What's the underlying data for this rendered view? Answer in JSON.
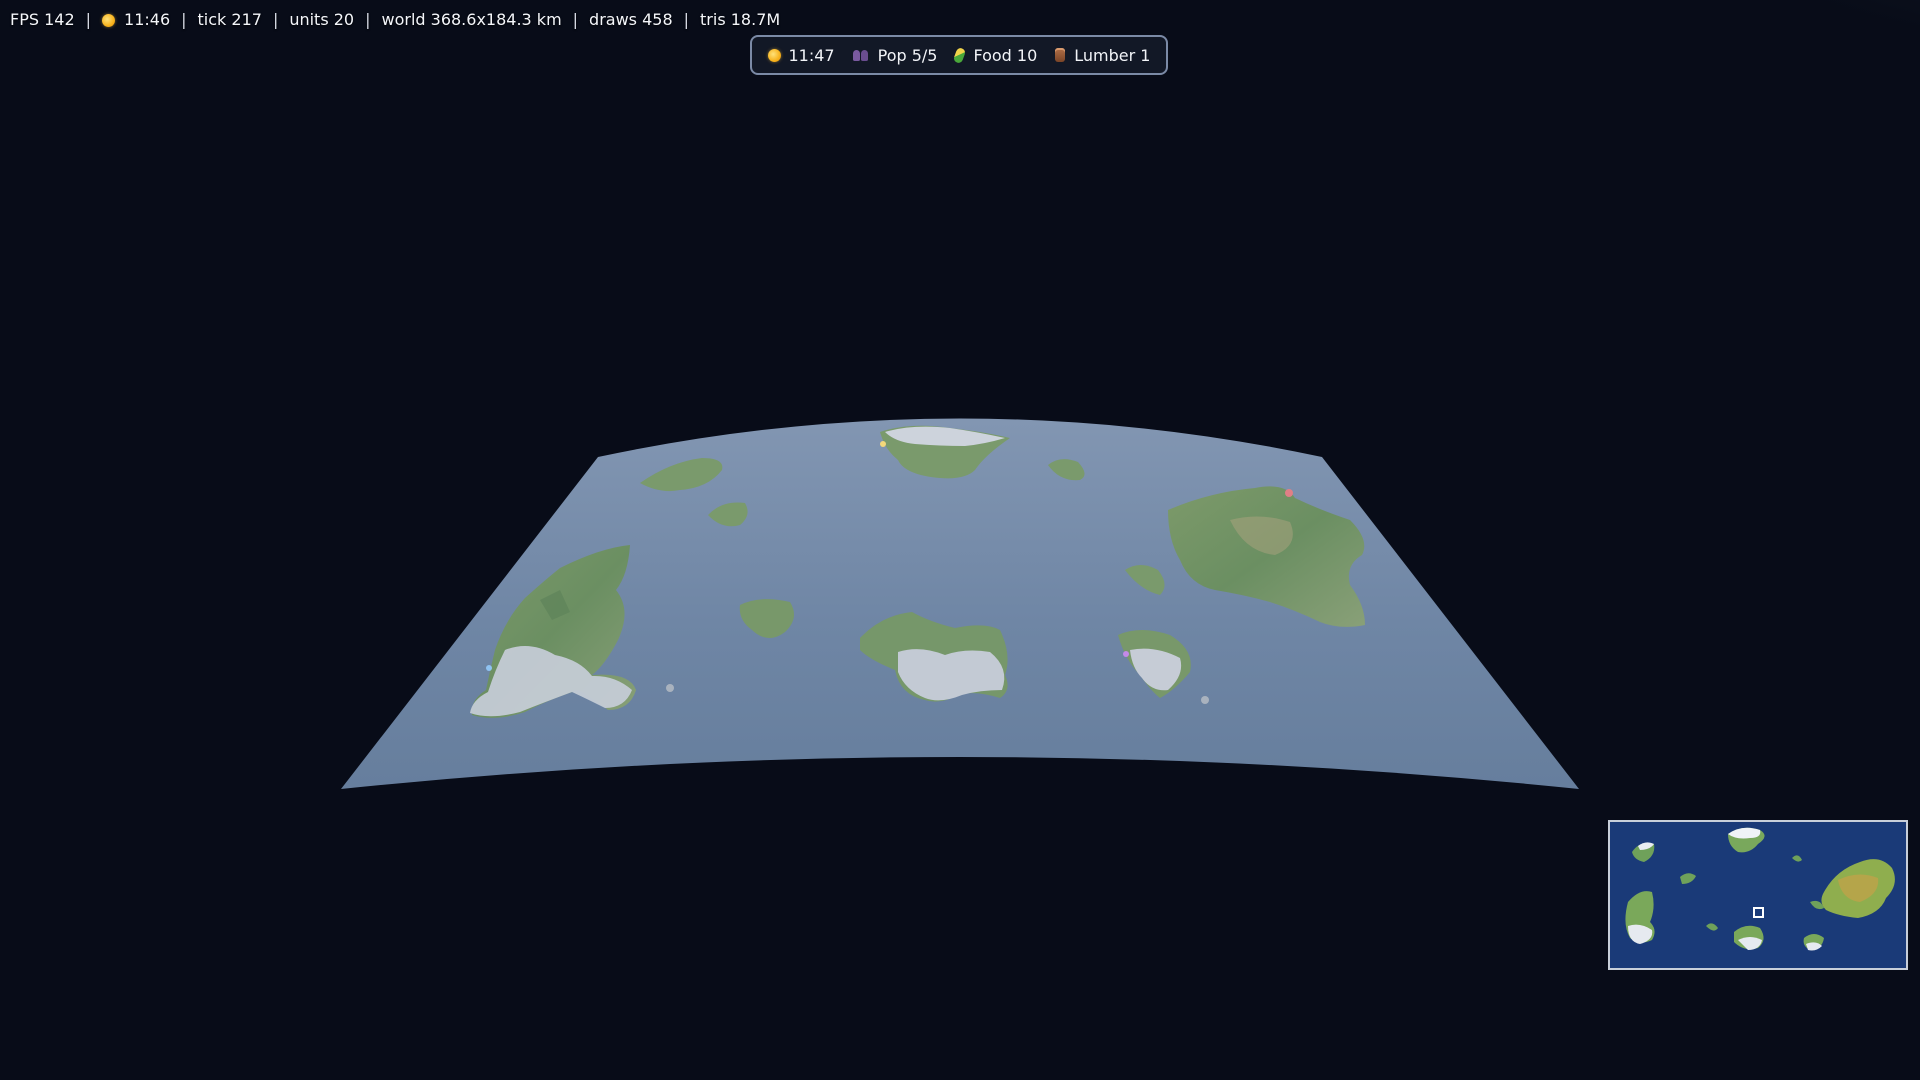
{
  "debug_overlay": {
    "fps": "FPS 142",
    "time": "11:46",
    "tick": "tick 217",
    "units": "units 20",
    "world": "world 368.6x184.3 km",
    "draws": "draws 458",
    "tris": "tris 18.7M"
  },
  "resource_bar": {
    "time": {
      "icon": "sun-icon",
      "value": "11:47"
    },
    "population": {
      "icon": "population-icon",
      "value": "Pop 5/5"
    },
    "food": {
      "icon": "corn-icon",
      "value": "Food 10"
    },
    "lumber": {
      "icon": "log-icon",
      "value": "Lumber 1"
    }
  },
  "minimap": {
    "icon": "minimap-view-rect"
  },
  "colors": {
    "background": "#080c18",
    "ocean": "#7088a8",
    "minimap_ocean": "#1a3a78",
    "land": "#6f9266",
    "snow": "#c7cdd6"
  }
}
